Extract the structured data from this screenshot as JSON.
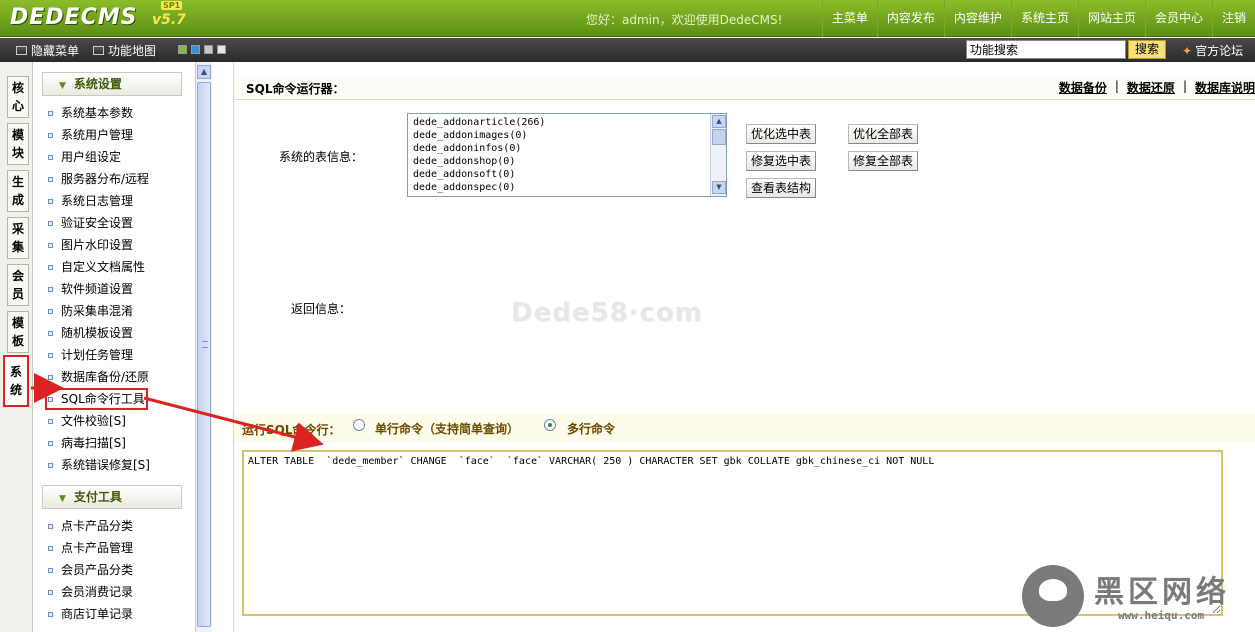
{
  "header": {
    "logo_text": "DEDECMS",
    "logo_version": "v5.7",
    "logo_badge": "SP1",
    "welcome": "您好：admin，欢迎使用DedeCMS!",
    "nav": [
      "主菜单",
      "内容发布",
      "内容维护",
      "系统主页",
      "网站主页",
      "会员中心",
      "注销"
    ]
  },
  "toolbar": {
    "hide_menu": "隐藏菜单",
    "function_map": "功能地图",
    "search_value": "功能搜索",
    "search_button": "搜索",
    "forum": "官方论坛",
    "swatch_colors": [
      "#7fbf3a",
      "#3a8fd0",
      "#c8c8c8",
      "#e6e6e6"
    ]
  },
  "vtabs": [
    "核心",
    "模块",
    "生成",
    "采集",
    "会员",
    "模板",
    "系统"
  ],
  "active_vtab": "系统",
  "menu": {
    "section1_title": "系统设置",
    "section1_items": [
      "系统基本参数",
      "系统用户管理",
      "用户组设定",
      "服务器分布/远程",
      "系统日志管理",
      "验证安全设置",
      "图片水印设置",
      "自定义文档属性",
      "软件频道设置",
      "防采集串混淆",
      "随机模板设置",
      "计划任务管理",
      "数据库备份/还原",
      "SQL命令行工具",
      "文件校验[S]",
      "病毒扫描[S]",
      "系统错误修复[S]"
    ],
    "section2_title": "支付工具",
    "section2_items": [
      "点卡产品分类",
      "点卡产品管理",
      "会员产品分类",
      "会员消费记录",
      "商店订单记录"
    ]
  },
  "main": {
    "title": "SQL命令运行器：",
    "links": [
      "数据备份",
      "数据还原",
      "数据库说明"
    ],
    "table_info_label": "系统的表信息：",
    "tables": [
      "dede_addonarticle(266)",
      "dede_addonimages(0)",
      "dede_addoninfos(0)",
      "dede_addonshop(0)",
      "dede_addonsoft(0)",
      "dede_addonspec(0)"
    ],
    "buttons": {
      "optimize_selected": "优化选中表",
      "optimize_all": "优化全部表",
      "repair_selected": "修复选中表",
      "repair_all": "修复全部表",
      "view_structure": "查看表结构"
    },
    "return_label": "返回信息：",
    "watermark": "Dede58·com",
    "run_label": "运行SQL命令行：",
    "radio_single": "单行命令（支持简单查询）",
    "radio_multi": "多行命令",
    "selected_mode": "多行命令",
    "sql_text": "ALTER TABLE  `dede_member` CHANGE  `face`  `face` VARCHAR( 250 ) CHARACTER SET gbk COLLATE gbk_chinese_ci NOT NULL"
  },
  "brand": {
    "cn": "黑区网络",
    "url": "www.heiqu.com"
  },
  "colors": {
    "topbar": "#6fa31c",
    "annotation": "#dd2222",
    "accent_text": "#6b4a00"
  }
}
